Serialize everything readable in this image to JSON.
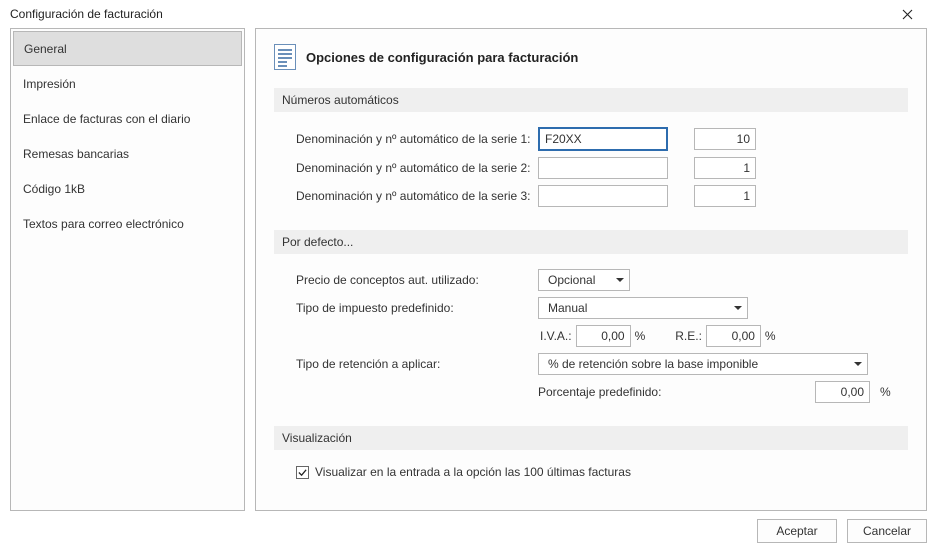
{
  "window": {
    "title": "Configuración de facturación"
  },
  "sidebar": {
    "items": [
      {
        "label": "General"
      },
      {
        "label": "Impresión"
      },
      {
        "label": "Enlace de facturas con el diario"
      },
      {
        "label": "Remesas bancarias"
      },
      {
        "label": "Código 1kB"
      },
      {
        "label": "Textos para correo electrónico"
      }
    ]
  },
  "page": {
    "title": "Opciones de configuración para facturación"
  },
  "sections": {
    "numeros": {
      "title": "Números automáticos",
      "rows": [
        {
          "label": "Denominación y nº automático de la serie 1:",
          "text": "F20XX",
          "num": "10"
        },
        {
          "label": "Denominación y nº automático de la serie 2:",
          "text": "",
          "num": "1"
        },
        {
          "label": "Denominación y nº automático de la serie 3:",
          "text": "",
          "num": "1"
        }
      ]
    },
    "defecto": {
      "title": "Por defecto...",
      "precio_label": "Precio de conceptos aut. utilizado:",
      "precio_value": "Opcional",
      "tipo_imp_label": "Tipo de impuesto predefinido:",
      "tipo_imp_value": "Manual",
      "iva_label": "I.V.A.:",
      "iva_value": "0,00",
      "re_label": "R.E.:",
      "re_value": "0,00",
      "percent_sign": "%",
      "ret_label": "Tipo de retención a aplicar:",
      "ret_value": "% de retención sobre la base imponible",
      "porc_label": "Porcentaje predefinido:",
      "porc_value": "0,00"
    },
    "vis": {
      "title": "Visualización",
      "check_label": "Visualizar en la entrada a la opción las 100 últimas facturas",
      "checked": true
    }
  },
  "footer": {
    "ok": "Aceptar",
    "cancel": "Cancelar"
  }
}
